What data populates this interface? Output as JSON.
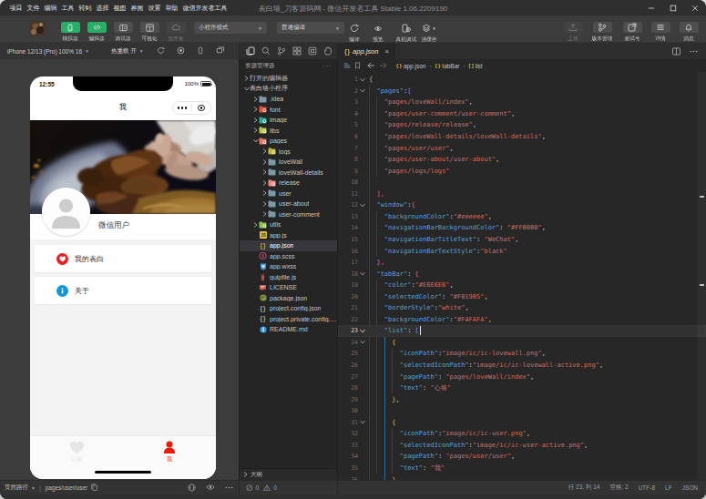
{
  "titlebar": {
    "menus": [
      "项目",
      "文件",
      "编辑",
      "工具",
      "转到",
      "选择",
      "视图",
      "界面",
      "设置",
      "帮助",
      "微信开发者工具"
    ],
    "title": "表白墙_刀客源码网 - 微信开发者工具 Stable 1.06.2209190",
    "window_controls": [
      "minimize",
      "maximize",
      "close"
    ]
  },
  "toolbar": {
    "left_buttons": [
      {
        "label": "模拟器",
        "icon": "phone-icon",
        "state": "active"
      },
      {
        "label": "编辑器",
        "icon": "code-icon",
        "state": "active"
      },
      {
        "label": "调试器",
        "icon": "debugger-icon",
        "state": "normal"
      },
      {
        "label": "可视化",
        "icon": "layout-icon",
        "state": "normal"
      },
      {
        "label": "云开发",
        "icon": "cloud-icon",
        "state": "disabled"
      }
    ],
    "mode_dropdown": "小程序模式",
    "compile_dropdown": "普通编译",
    "action_buttons": [
      {
        "label": "编译",
        "icon": "refresh-icon"
      },
      {
        "label": "预览",
        "icon": "eye-icon"
      },
      {
        "label": "真机调试",
        "icon": "device-debug-icon"
      },
      {
        "label": "清缓存",
        "icon": "clear-cache-icon",
        "has_caret": true
      }
    ],
    "right_buttons": [
      {
        "label": "上传",
        "icon": "upload-icon",
        "state": "disabled"
      },
      {
        "label": "版本管理",
        "icon": "branch-icon",
        "state": "normal"
      },
      {
        "label": "测试号",
        "icon": "external-icon",
        "state": "normal"
      },
      {
        "label": "详情",
        "icon": "details-icon",
        "state": "normal"
      },
      {
        "label": "消息",
        "icon": "bell-icon",
        "state": "normal"
      }
    ],
    "accent_green": "#2aae67"
  },
  "device_bar": {
    "device": "iPhone 12/13 (Pro) 100% 16",
    "hot_reload": "热重载 开",
    "icons": [
      "rotate-icon",
      "record-icon",
      "phone-frame-icon",
      "multi-device-icon"
    ]
  },
  "simulator": {
    "status_time": "12:55",
    "battery_text": "100%",
    "nav_title": "我",
    "nickname": "微信用户",
    "cells": [
      {
        "icon": "heart-badge",
        "color": "#ed1c24",
        "text": "我的表白"
      },
      {
        "icon": "info-badge",
        "color": "#1296db",
        "text": "关于"
      }
    ],
    "tabbar": [
      {
        "icon": "heart-tab-icon",
        "label": "心墙",
        "color": "#E6E6E6",
        "selected": false
      },
      {
        "icon": "user-tab-icon",
        "label": "我",
        "color": "#F01905",
        "selected": true
      }
    ],
    "page_background": "#f3f3f3"
  },
  "path_bar": {
    "label": "页面路径",
    "path": "pages/user/user",
    "icons": [
      "copy-icon",
      "bug-icon",
      "eye-icon",
      "more-icon"
    ]
  },
  "explorer": {
    "strip_icons": [
      "files-icon",
      "search-icon",
      "git-branch-icon",
      "grid-icon",
      "package-icon",
      "hand-icon"
    ],
    "header": "资源管理器",
    "sections": {
      "open_editors": "打开的编辑器",
      "outline": "大纲"
    },
    "tree": [
      {
        "name": "打开的编辑器",
        "kind": "section",
        "level": 0,
        "chevron": "right"
      },
      {
        "name": "表白墙小程序",
        "kind": "root",
        "level": 0,
        "chevron": "down"
      },
      {
        "name": ".idea",
        "kind": "folder",
        "level": 1,
        "chevron": "right",
        "color": "#7d99a5"
      },
      {
        "name": "font",
        "kind": "folder",
        "level": 1,
        "chevron": "right",
        "color": "#e0503d",
        "badge": "A"
      },
      {
        "name": "image",
        "kind": "folder",
        "level": 1,
        "chevron": "right",
        "color": "#26a69a",
        "badge": "img"
      },
      {
        "name": "libs",
        "kind": "folder",
        "level": 1,
        "chevron": "right",
        "color": "#b8c24a",
        "badge": "lib"
      },
      {
        "name": "pages",
        "kind": "folder",
        "level": 1,
        "chevron": "down",
        "color": "#e57368",
        "badge": "pg"
      },
      {
        "name": "logs",
        "kind": "folder",
        "level": 2,
        "chevron": "right",
        "color": "#c3b139",
        "badge": "tmp"
      },
      {
        "name": "loveWall",
        "kind": "folder",
        "level": 2,
        "chevron": "right",
        "color": "#7d99a5"
      },
      {
        "name": "loveWall-details",
        "kind": "folder",
        "level": 2,
        "chevron": "right",
        "color": "#7d99a5"
      },
      {
        "name": "release",
        "kind": "folder",
        "level": 2,
        "chevron": "right",
        "color": "#ef8a80",
        "badge": "rel"
      },
      {
        "name": "user",
        "kind": "folder",
        "level": 2,
        "chevron": "right",
        "color": "#7d99a5"
      },
      {
        "name": "user-about",
        "kind": "folder",
        "level": 2,
        "chevron": "right",
        "color": "#7d99a5"
      },
      {
        "name": "user-comment",
        "kind": "folder",
        "level": 2,
        "chevron": "right",
        "color": "#7d99a5"
      },
      {
        "name": "utils",
        "kind": "folder",
        "level": 1,
        "chevron": "right",
        "color": "#8bc34a",
        "badge": "u"
      },
      {
        "name": "app.js",
        "kind": "file",
        "level": 1,
        "icon": "js"
      },
      {
        "name": "app.json",
        "kind": "file",
        "level": 1,
        "icon": "braces-gold",
        "selected": true
      },
      {
        "name": "app.scss",
        "kind": "file",
        "level": 1,
        "icon": "sass"
      },
      {
        "name": "app.wxss",
        "kind": "file",
        "level": 1,
        "icon": "wxss"
      },
      {
        "name": "gulpfile.js",
        "kind": "file",
        "level": 1,
        "icon": "gulp"
      },
      {
        "name": "LICENSE",
        "kind": "file",
        "level": 1,
        "icon": "license"
      },
      {
        "name": "package.json",
        "kind": "file",
        "level": 1,
        "icon": "npm"
      },
      {
        "name": "project.config.json",
        "kind": "file",
        "level": 1,
        "icon": "braces-gray"
      },
      {
        "name": "project.private.config.js…",
        "kind": "file",
        "level": 1,
        "icon": "braces-gray"
      },
      {
        "name": "README.md",
        "kind": "file",
        "level": 1,
        "icon": "readme"
      }
    ],
    "problems": {
      "errors": 0,
      "warnings": 0
    }
  },
  "editor": {
    "tab": {
      "icon": "braces-icon",
      "label": "app.json",
      "close": "×",
      "modified": false
    },
    "tab_right_icons": [
      "split-editor-icon",
      "more-icon"
    ],
    "breadcrumb": [
      {
        "icon": "{}",
        "label": "app.json"
      },
      {
        "icon": "{}",
        "label": "tabBar"
      },
      {
        "icon": "[]",
        "label": "list"
      }
    ],
    "breadcrumb_left_icons": [
      "list-icon",
      "bookmark-icon",
      "arrow-left-icon",
      "arrow-right-icon"
    ],
    "cursor": {
      "line": 23,
      "col": 14
    },
    "code_lines": [
      {
        "n": 1,
        "fold": "down",
        "parts": [
          [
            "{",
            "b1"
          ]
        ]
      },
      {
        "n": 2,
        "fold": "down",
        "parts": [
          [
            "  ",
            "p"
          ],
          [
            "\"pages\"",
            "k"
          ],
          [
            ":",
            "p"
          ],
          [
            "[",
            "b2"
          ]
        ]
      },
      {
        "n": 3,
        "parts": [
          [
            "    ",
            "p"
          ],
          [
            "\"pages/loveWall/index\"",
            "v"
          ],
          [
            ",",
            "p"
          ]
        ]
      },
      {
        "n": 4,
        "parts": [
          [
            "    ",
            "p"
          ],
          [
            "\"pages/user-comment/user-comment\"",
            "v"
          ],
          [
            ",",
            "p"
          ]
        ]
      },
      {
        "n": 5,
        "parts": [
          [
            "    ",
            "p"
          ],
          [
            "\"pages/release/release\"",
            "v"
          ],
          [
            ",",
            "p"
          ]
        ]
      },
      {
        "n": 6,
        "parts": [
          [
            "    ",
            "p"
          ],
          [
            "\"pages/loveWall-details/loveWall-details\"",
            "v"
          ],
          [
            ",",
            "p"
          ]
        ]
      },
      {
        "n": 7,
        "parts": [
          [
            "    ",
            "p"
          ],
          [
            "\"pages/user/user\"",
            "v"
          ],
          [
            ",",
            "p"
          ]
        ]
      },
      {
        "n": 8,
        "parts": [
          [
            "    ",
            "p"
          ],
          [
            "\"pages/user-about/user-about\"",
            "v"
          ],
          [
            ",",
            "p"
          ]
        ]
      },
      {
        "n": 9,
        "parts": [
          [
            "    ",
            "p"
          ],
          [
            "\"pages/logs/logs\"",
            "v"
          ]
        ]
      },
      {
        "n": 10,
        "parts": []
      },
      {
        "n": 11,
        "parts": [
          [
            "  ",
            "p"
          ],
          [
            "]",
            "b2"
          ],
          [
            ",",
            "b2"
          ]
        ]
      },
      {
        "n": 12,
        "fold": "down",
        "parts": [
          [
            "  ",
            "p"
          ],
          [
            "\"window\"",
            "k"
          ],
          [
            ":",
            "p"
          ],
          [
            "{",
            "b2"
          ]
        ]
      },
      {
        "n": 13,
        "parts": [
          [
            "    ",
            "p"
          ],
          [
            "\"backgroundColor\"",
            "k"
          ],
          [
            ":",
            "p"
          ],
          [
            "\"#eeeeee\"",
            "v"
          ],
          [
            ",",
            "p"
          ]
        ]
      },
      {
        "n": 14,
        "parts": [
          [
            "    ",
            "p"
          ],
          [
            "\"navigationBarBackgroundColor\"",
            "k"
          ],
          [
            ": ",
            "p"
          ],
          [
            "\"#FF0000\"",
            "v"
          ],
          [
            ",",
            "p"
          ]
        ]
      },
      {
        "n": 15,
        "parts": [
          [
            "    ",
            "p"
          ],
          [
            "\"navigationBarTitleText\"",
            "k"
          ],
          [
            ": ",
            "p"
          ],
          [
            "\"WeChat\"",
            "v"
          ],
          [
            ",",
            "p"
          ]
        ]
      },
      {
        "n": 16,
        "parts": [
          [
            "    ",
            "p"
          ],
          [
            "\"navigationBarTextStyle\"",
            "k"
          ],
          [
            ":",
            "p"
          ],
          [
            "\"black\"",
            "v"
          ]
        ]
      },
      {
        "n": 17,
        "parts": [
          [
            "  ",
            "p"
          ],
          [
            "}",
            "b2"
          ],
          [
            ",",
            "b2"
          ]
        ]
      },
      {
        "n": 18,
        "fold": "down",
        "parts": [
          [
            "  ",
            "p"
          ],
          [
            "\"tabBar\"",
            "k"
          ],
          [
            ": ",
            "p"
          ],
          [
            "{",
            "b2"
          ]
        ]
      },
      {
        "n": 19,
        "parts": [
          [
            "    ",
            "p"
          ],
          [
            "\"color\"",
            "k"
          ],
          [
            ":",
            "p"
          ],
          [
            "\"#E6E6E6\"",
            "v"
          ],
          [
            ",",
            "p"
          ]
        ]
      },
      {
        "n": 20,
        "parts": [
          [
            "    ",
            "p"
          ],
          [
            "\"selectedColor\"",
            "k"
          ],
          [
            ": ",
            "p"
          ],
          [
            "\"#F01905\"",
            "v"
          ],
          [
            ",",
            "p"
          ]
        ]
      },
      {
        "n": 21,
        "parts": [
          [
            "    ",
            "p"
          ],
          [
            "\"borderStyle\"",
            "k"
          ],
          [
            ":",
            "p"
          ],
          [
            "\"white\"",
            "v"
          ],
          [
            ",",
            "p"
          ]
        ]
      },
      {
        "n": 22,
        "parts": [
          [
            "    ",
            "p"
          ],
          [
            "\"backgroundColor\"",
            "k"
          ],
          [
            ":",
            "p"
          ],
          [
            "\"#FAFAFA\"",
            "v"
          ],
          [
            ",",
            "p"
          ]
        ]
      },
      {
        "n": 23,
        "fold": "down",
        "current": true,
        "cursor_after": true,
        "parts": [
          [
            "    ",
            "p"
          ],
          [
            "\"list\"",
            "k"
          ],
          [
            ": ",
            "p"
          ],
          [
            "[",
            "b3"
          ]
        ]
      },
      {
        "n": 24,
        "fold": "down",
        "parts": [
          [
            "      ",
            "p"
          ],
          [
            "{",
            "b1"
          ]
        ]
      },
      {
        "n": 25,
        "parts": [
          [
            "        ",
            "p"
          ],
          [
            "\"iconPath\"",
            "k"
          ],
          [
            ":",
            "p"
          ],
          [
            "\"image/ic/ic-lovewall.png\"",
            "v"
          ],
          [
            ",",
            "p"
          ]
        ]
      },
      {
        "n": 26,
        "parts": [
          [
            "        ",
            "p"
          ],
          [
            "\"selectedIconPath\"",
            "k"
          ],
          [
            ":",
            "p"
          ],
          [
            "\"image/ic/ic-lovewall-active.png\"",
            "v"
          ],
          [
            ",",
            "p"
          ]
        ]
      },
      {
        "n": 27,
        "parts": [
          [
            "        ",
            "p"
          ],
          [
            "\"pagePath\"",
            "k"
          ],
          [
            ": ",
            "p"
          ],
          [
            "\"pages/loveWall/index\"",
            "v"
          ],
          [
            ",",
            "p"
          ]
        ]
      },
      {
        "n": 28,
        "parts": [
          [
            "        ",
            "p"
          ],
          [
            "\"text\"",
            "k"
          ],
          [
            ": ",
            "p"
          ],
          [
            "\"心墙\"",
            "v"
          ]
        ]
      },
      {
        "n": 29,
        "parts": [
          [
            "      ",
            "p"
          ],
          [
            "}",
            "b1"
          ],
          [
            ",",
            "p"
          ]
        ]
      },
      {
        "n": 30,
        "parts": []
      },
      {
        "n": 31,
        "fold": "down",
        "parts": [
          [
            "      ",
            "p"
          ],
          [
            "{",
            "b1"
          ]
        ]
      },
      {
        "n": 32,
        "parts": [
          [
            "        ",
            "p"
          ],
          [
            "\"iconPath\"",
            "k"
          ],
          [
            ":",
            "p"
          ],
          [
            "\"image/ic/ic-user.png\"",
            "v"
          ],
          [
            ",",
            "p"
          ]
        ]
      },
      {
        "n": 33,
        "parts": [
          [
            "        ",
            "p"
          ],
          [
            "\"selectedIconPath\"",
            "k"
          ],
          [
            ":",
            "p"
          ],
          [
            "\"image/ic/ic-user-active.png\"",
            "v"
          ],
          [
            ",",
            "p"
          ]
        ]
      },
      {
        "n": 34,
        "parts": [
          [
            "        ",
            "p"
          ],
          [
            "\"pagePath\"",
            "k"
          ],
          [
            ": ",
            "p"
          ],
          [
            "\"pages/user/user\"",
            "v"
          ],
          [
            ",",
            "p"
          ]
        ]
      },
      {
        "n": 35,
        "parts": [
          [
            "        ",
            "p"
          ],
          [
            "\"text\"",
            "k"
          ],
          [
            ": ",
            "p"
          ],
          [
            "\"我\"",
            "v"
          ]
        ]
      },
      {
        "n": 36,
        "parts": [
          [
            "      ",
            "p"
          ],
          [
            "}",
            "b1"
          ]
        ]
      }
    ],
    "status": {
      "position": "行 23, 列 14",
      "spaces": "空格: 2",
      "encoding": "UTF-8",
      "eol": "LF",
      "language": "JSON"
    }
  },
  "colors": {
    "token_key": "#5aa0d8",
    "token_string": "#cd6f62",
    "bracket_gold": "#dfba6c",
    "bracket_pink": "#d465d0",
    "bracket_blue": "#3b9ef2",
    "editor_bg": "#272727",
    "panel_bg": "#252526",
    "chrome_bg": "#3c3c3c"
  }
}
